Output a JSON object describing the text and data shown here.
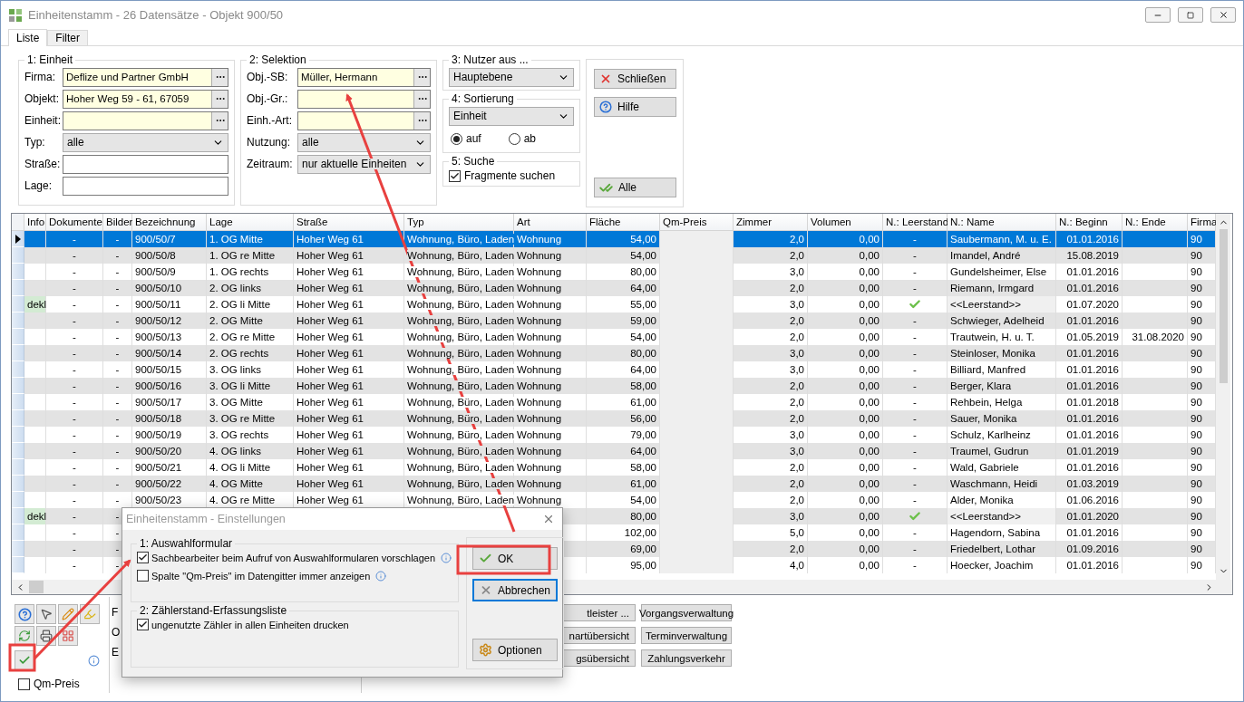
{
  "window": {
    "title": "Einheitenstamm - 26 Datensätze - Objekt 900/50"
  },
  "tabs": [
    {
      "label": "Liste",
      "selected": true
    },
    {
      "label": "Filter",
      "selected": false
    }
  ],
  "einheit": {
    "title": "1: Einheit",
    "fields": [
      {
        "label": "Firma:",
        "kind": "lookup",
        "value": "Deflize und Partner GmbH"
      },
      {
        "label": "Objekt:",
        "kind": "lookup",
        "value": "Hoher Weg 59 - 61, 67059"
      },
      {
        "label": "Einheit:",
        "kind": "lookup"
      },
      {
        "label": "Typ:",
        "kind": "select",
        "value": "alle"
      },
      {
        "label": "Straße:",
        "kind": "text"
      },
      {
        "label": "Lage:",
        "kind": "text"
      }
    ]
  },
  "selektion": {
    "title": "2: Selektion",
    "fields": [
      {
        "label": "Obj.-SB:",
        "kind": "lookup",
        "value": "Müller, Hermann"
      },
      {
        "label": "Obj.-Gr.:",
        "kind": "lookup"
      },
      {
        "label": "Einh.-Art:",
        "kind": "lookup"
      },
      {
        "label": "Nutzung:",
        "kind": "select",
        "value": "alle"
      },
      {
        "label": "Zeitraum:",
        "kind": "select",
        "value": "nur aktuelle Einheiten"
      }
    ]
  },
  "nutzer": {
    "title": "3: Nutzer aus ...",
    "value": "Hauptebene"
  },
  "sortierung": {
    "title": "4: Sortierung",
    "value": "Einheit",
    "options": [
      {
        "label": "auf",
        "selected": true
      },
      {
        "label": "ab",
        "selected": false
      }
    ]
  },
  "suche": {
    "title": "5: Suche",
    "checkbox": {
      "label": "Fragmente suchen",
      "checked": true
    }
  },
  "actions": [
    {
      "label": "Schließen",
      "kind": "close"
    },
    {
      "label": "Hilfe",
      "kind": "help"
    },
    {
      "label": "Alle",
      "kind": "all"
    }
  ],
  "table": {
    "columns": [
      "Info",
      "Dokumente",
      "Bilder",
      "Bezeichnung",
      "Lage",
      "Straße",
      "Typ",
      "Art",
      "Fläche",
      "Qm-Preis",
      "Zimmer",
      "Volumen",
      "N.: Leerstand",
      "N.: Name",
      "N.: Beginn",
      "N.: Ende",
      "Firma"
    ],
    "rows": [
      {
        "selected": true,
        "vacant": false,
        "dokumente": "-",
        "bilder": "-",
        "bezeichnung": "900/50/7",
        "lage": "1. OG Mitte",
        "strasse": "Hoher Weg 61",
        "typ": "Wohnung, Büro, Laden",
        "art": "Wohnung",
        "flaeche": "54,00",
        "zimmer": "2,0",
        "volumen": "0,00",
        "leerstand": "-",
        "name": "Saubermann, M. u. E.",
        "beginn": "01.01.2016",
        "firma": "90"
      },
      {
        "selected": false,
        "vacant": false,
        "dokumente": "-",
        "bilder": "-",
        "bezeichnung": "900/50/8",
        "lage": "1. OG re Mitte",
        "strasse": "Hoher Weg 61",
        "typ": "Wohnung, Büro, Laden",
        "art": "Wohnung",
        "flaeche": "54,00",
        "zimmer": "2,0",
        "volumen": "0,00",
        "leerstand": "-",
        "name": "Imandel, André",
        "beginn": "15.08.2019",
        "firma": "90"
      },
      {
        "selected": false,
        "vacant": false,
        "dokumente": "-",
        "bilder": "-",
        "bezeichnung": "900/50/9",
        "lage": "1. OG rechts",
        "strasse": "Hoher Weg 61",
        "typ": "Wohnung, Büro, Laden",
        "art": "Wohnung",
        "flaeche": "80,00",
        "zimmer": "3,0",
        "volumen": "0,00",
        "leerstand": "-",
        "name": "Gundelsheimer, Else",
        "beginn": "01.01.2016",
        "firma": "90"
      },
      {
        "selected": false,
        "vacant": false,
        "dokumente": "-",
        "bilder": "-",
        "bezeichnung": "900/50/10",
        "lage": "2. OG links",
        "strasse": "Hoher Weg 61",
        "typ": "Wohnung, Büro, Laden",
        "art": "Wohnung",
        "flaeche": "64,00",
        "zimmer": "2,0",
        "volumen": "0,00",
        "leerstand": "-",
        "name": "Riemann, Irmgard",
        "beginn": "01.01.2016",
        "firma": "90"
      },
      {
        "selected": false,
        "vacant": true,
        "info": "dekl",
        "dokumente": "-",
        "bilder": "-",
        "bezeichnung": "900/50/11",
        "lage": "2. OG li Mitte",
        "strasse": "Hoher Weg 61",
        "typ": "Wohnung, Büro, Laden",
        "art": "Wohnung",
        "flaeche": "55,00",
        "zimmer": "3,0",
        "volumen": "0,00",
        "name": "<<Leerstand>>",
        "beginn": "01.07.2020",
        "firma": "90"
      },
      {
        "selected": false,
        "vacant": false,
        "dokumente": "-",
        "bilder": "-",
        "bezeichnung": "900/50/12",
        "lage": "2. OG Mitte",
        "strasse": "Hoher Weg 61",
        "typ": "Wohnung, Büro, Laden",
        "art": "Wohnung",
        "flaeche": "59,00",
        "zimmer": "2,0",
        "volumen": "0,00",
        "leerstand": "-",
        "name": "Schwieger, Adelheid",
        "beginn": "01.01.2016",
        "firma": "90"
      },
      {
        "selected": false,
        "vacant": false,
        "dokumente": "-",
        "bilder": "-",
        "bezeichnung": "900/50/13",
        "lage": "2. OG re Mitte",
        "strasse": "Hoher Weg 61",
        "typ": "Wohnung, Büro, Laden",
        "art": "Wohnung",
        "flaeche": "54,00",
        "zimmer": "2,0",
        "volumen": "0,00",
        "leerstand": "-",
        "name": "Trautwein, H. u. T.",
        "beginn": "01.05.2019",
        "ende": "31.08.2020",
        "firma": "90"
      },
      {
        "selected": false,
        "vacant": false,
        "dokumente": "-",
        "bilder": "-",
        "bezeichnung": "900/50/14",
        "lage": "2. OG rechts",
        "strasse": "Hoher Weg 61",
        "typ": "Wohnung, Büro, Laden",
        "art": "Wohnung",
        "flaeche": "80,00",
        "zimmer": "3,0",
        "volumen": "0,00",
        "leerstand": "-",
        "name": "Steinloser, Monika",
        "beginn": "01.01.2016",
        "firma": "90"
      },
      {
        "selected": false,
        "vacant": false,
        "dokumente": "-",
        "bilder": "-",
        "bezeichnung": "900/50/15",
        "lage": "3. OG links",
        "strasse": "Hoher Weg 61",
        "typ": "Wohnung, Büro, Laden",
        "art": "Wohnung",
        "flaeche": "64,00",
        "zimmer": "3,0",
        "volumen": "0,00",
        "leerstand": "-",
        "name": "Billiard, Manfred",
        "beginn": "01.01.2016",
        "firma": "90"
      },
      {
        "selected": false,
        "vacant": false,
        "dokumente": "-",
        "bilder": "-",
        "bezeichnung": "900/50/16",
        "lage": "3. OG li Mitte",
        "strasse": "Hoher Weg 61",
        "typ": "Wohnung, Büro, Laden",
        "art": "Wohnung",
        "flaeche": "58,00",
        "zimmer": "2,0",
        "volumen": "0,00",
        "leerstand": "-",
        "name": "Berger, Klara",
        "beginn": "01.01.2016",
        "firma": "90"
      },
      {
        "selected": false,
        "vacant": false,
        "dokumente": "-",
        "bilder": "-",
        "bezeichnung": "900/50/17",
        "lage": "3. OG Mitte",
        "strasse": "Hoher Weg 61",
        "typ": "Wohnung, Büro, Laden",
        "art": "Wohnung",
        "flaeche": "61,00",
        "zimmer": "2,0",
        "volumen": "0,00",
        "leerstand": "-",
        "name": "Rehbein, Helga",
        "beginn": "01.01.2018",
        "firma": "90"
      },
      {
        "selected": false,
        "vacant": false,
        "dokumente": "-",
        "bilder": "-",
        "bezeichnung": "900/50/18",
        "lage": "3. OG re Mitte",
        "strasse": "Hoher Weg 61",
        "typ": "Wohnung, Büro, Laden",
        "art": "Wohnung",
        "flaeche": "56,00",
        "zimmer": "2,0",
        "volumen": "0,00",
        "leerstand": "-",
        "name": "Sauer, Monika",
        "beginn": "01.01.2016",
        "firma": "90"
      },
      {
        "selected": false,
        "vacant": false,
        "dokumente": "-",
        "bilder": "-",
        "bezeichnung": "900/50/19",
        "lage": "3. OG rechts",
        "strasse": "Hoher Weg 61",
        "typ": "Wohnung, Büro, Laden",
        "art": "Wohnung",
        "flaeche": "79,00",
        "zimmer": "3,0",
        "volumen": "0,00",
        "leerstand": "-",
        "name": "Schulz, Karlheinz",
        "beginn": "01.01.2016",
        "firma": "90"
      },
      {
        "selected": false,
        "vacant": false,
        "dokumente": "-",
        "bilder": "-",
        "bezeichnung": "900/50/20",
        "lage": "4. OG links",
        "strasse": "Hoher Weg 61",
        "typ": "Wohnung, Büro, Laden",
        "art": "Wohnung",
        "flaeche": "64,00",
        "zimmer": "3,0",
        "volumen": "0,00",
        "leerstand": "-",
        "name": "Traumel, Gudrun",
        "beginn": "01.01.2019",
        "firma": "90"
      },
      {
        "selected": false,
        "vacant": false,
        "dokumente": "-",
        "bilder": "-",
        "bezeichnung": "900/50/21",
        "lage": "4. OG li Mitte",
        "strasse": "Hoher Weg 61",
        "typ": "Wohnung, Büro, Laden",
        "art": "Wohnung",
        "flaeche": "58,00",
        "zimmer": "2,0",
        "volumen": "0,00",
        "leerstand": "-",
        "name": "Wald, Gabriele",
        "beginn": "01.01.2016",
        "firma": "90"
      },
      {
        "selected": false,
        "vacant": false,
        "dokumente": "-",
        "bilder": "-",
        "bezeichnung": "900/50/22",
        "lage": "4. OG Mitte",
        "strasse": "Hoher Weg 61",
        "typ": "Wohnung, Büro, Laden",
        "art": "Wohnung",
        "flaeche": "61,00",
        "zimmer": "2,0",
        "volumen": "0,00",
        "leerstand": "-",
        "name": "Waschmann, Heidi",
        "beginn": "01.03.2019",
        "firma": "90"
      },
      {
        "selected": false,
        "vacant": false,
        "dokumente": "-",
        "bilder": "-",
        "bezeichnung": "900/50/23",
        "lage": "4. OG re Mitte",
        "strasse": "Hoher Weg 61",
        "typ": "Wohnung, Büro, Laden",
        "art": "Wohnung",
        "flaeche": "54,00",
        "zimmer": "2,0",
        "volumen": "0,00",
        "leerstand": "-",
        "name": "Alder, Monika",
        "beginn": "01.06.2016",
        "firma": "90"
      },
      {
        "selected": false,
        "vacant": true,
        "info": "dekl",
        "dokumente": "-",
        "bilder": "-",
        "flaeche": "80,00",
        "zimmer": "3,0",
        "volumen": "0,00",
        "name": "<<Leerstand>>",
        "beginn": "01.01.2020",
        "firma": "90"
      },
      {
        "selected": false,
        "vacant": false,
        "dokumente": "-",
        "bilder": "-",
        "flaeche": "102,00",
        "zimmer": "5,0",
        "volumen": "0,00",
        "leerstand": "-",
        "name": "Hagendorn, Sabina",
        "beginn": "01.01.2016",
        "firma": "90"
      },
      {
        "selected": false,
        "vacant": false,
        "dokumente": "-",
        "bilder": "-",
        "flaeche": "69,00",
        "zimmer": "2,0",
        "volumen": "0,00",
        "leerstand": "-",
        "name": "Friedelbert, Lothar",
        "beginn": "01.09.2016",
        "firma": "90"
      },
      {
        "selected": false,
        "vacant": false,
        "dokumente": "-",
        "bilder": "-",
        "flaeche": "95,00",
        "zimmer": "4,0",
        "volumen": "0,00",
        "leerstand": "-",
        "name": "Hoecker, Joachim",
        "beginn": "01.01.2016",
        "firma": "90"
      }
    ]
  },
  "tools": {
    "toggle_checked": true,
    "qm_preis": {
      "label": "Qm-Preis",
      "checked": false
    }
  },
  "side_labels": [
    "F",
    "O",
    "E"
  ],
  "buttons": [
    [
      "tleister ...",
      "Vorgangsverwaltung"
    ],
    [
      "nartübersicht",
      "Terminverwaltung"
    ],
    [
      "gsübersicht",
      "Zahlungsverkehr"
    ]
  ],
  "dialog": {
    "title": "Einheitenstamm - Einstellungen",
    "groups": [
      {
        "title": "1: Auswahlformular",
        "options": [
          {
            "label": "Sachbearbeiter beim Aufruf von Auswahlformularen vorschlagen",
            "checked": true,
            "info": true
          },
          {
            "label": "Spalte \"Qm-Preis\" im Datengitter immer anzeigen",
            "checked": false,
            "info": true
          }
        ]
      },
      {
        "title": "2: Zählerstand-Erfassungsliste",
        "options": [
          {
            "label": "ungenutzte Zähler in allen Einheiten drucken",
            "checked": true,
            "info": false
          }
        ]
      }
    ],
    "buttons": [
      {
        "label": "OK",
        "kind": "ok",
        "focused": false
      },
      {
        "label": "Abbrechen",
        "kind": "cancel",
        "focused": true
      },
      {
        "label": "Optionen",
        "kind": "options",
        "focused": false
      }
    ]
  }
}
